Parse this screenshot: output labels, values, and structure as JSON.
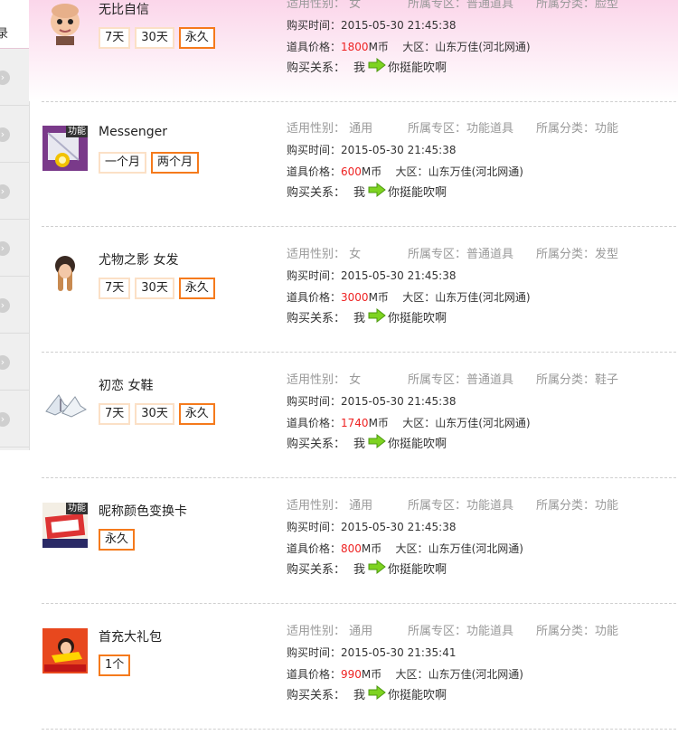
{
  "sidebar": {
    "top_label": "录",
    "arrow_glyph": "›"
  },
  "labels": {
    "gender": "适用性别：",
    "zone": "所属专区：",
    "category": "所属分类：",
    "time": "购买时间：",
    "price": "道具价格：",
    "price_unit": "M币",
    "region": "大区：",
    "relation": "购买关系：",
    "me": "我",
    "friend": "你挺能吹啊"
  },
  "items": [
    {
      "name": "无比自信",
      "tag": "",
      "options": [
        "7天",
        "30天",
        "永久"
      ],
      "selected": 2,
      "gender": "女",
      "zone": "普通道具",
      "category": "脸型",
      "time": "2015-05-30 21:45:38",
      "price": "1800",
      "region": "山东万佳(河北网通)"
    },
    {
      "name": "Messenger",
      "tag": "功能",
      "options": [
        "一个月",
        "两个月"
      ],
      "selected": 1,
      "gender": "通用",
      "zone": "功能道具",
      "category": "功能",
      "time": "2015-05-30 21:45:38",
      "price": "600",
      "region": "山东万佳(河北网通)"
    },
    {
      "name": "尤物之影 女发",
      "tag": "",
      "options": [
        "7天",
        "30天",
        "永久"
      ],
      "selected": 2,
      "gender": "女",
      "zone": "普通道具",
      "category": "发型",
      "time": "2015-05-30 21:45:38",
      "price": "3000",
      "region": "山东万佳(河北网通)"
    },
    {
      "name": "初恋 女鞋",
      "tag": "",
      "options": [
        "7天",
        "30天",
        "永久"
      ],
      "selected": 2,
      "gender": "女",
      "zone": "普通道具",
      "category": "鞋子",
      "time": "2015-05-30 21:45:38",
      "price": "1740",
      "region": "山东万佳(河北网通)"
    },
    {
      "name": "昵称颜色变换卡",
      "tag": "功能",
      "options": [
        "永久"
      ],
      "selected": 0,
      "gender": "通用",
      "zone": "功能道具",
      "category": "功能",
      "time": "2015-05-30 21:45:38",
      "price": "800",
      "region": "山东万佳(河北网通)"
    },
    {
      "name": "首充大礼包",
      "tag": "",
      "options": [
        "1个"
      ],
      "selected": 0,
      "gender": "通用",
      "zone": "功能道具",
      "category": "功能",
      "time": "2015-05-30 21:35:41",
      "price": "990",
      "region": "山东万佳(河北网通)"
    }
  ]
}
